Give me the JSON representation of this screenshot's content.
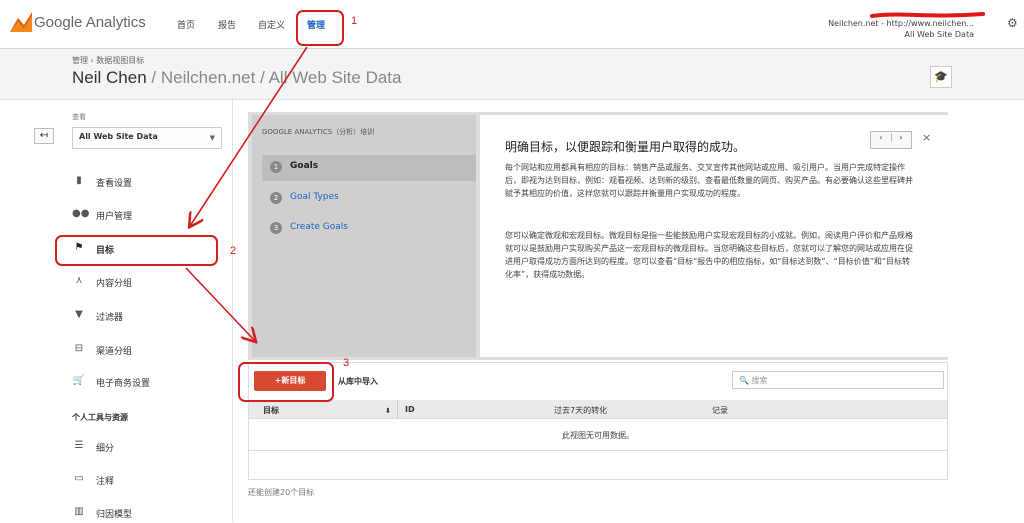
{
  "header": {
    "logo": "Google Analytics",
    "nav": [
      "首页",
      "报告",
      "自定义",
      "管理"
    ],
    "account_line1": "Neilchen.net - http://www.neilchen...",
    "account_line2": "All Web Site Data"
  },
  "subheader": {
    "breadcrumb": "管理 › 数据视图目标",
    "title_main": "Neil Chen",
    "title_rest": "/ Neilchen.net / All Web Site Data"
  },
  "sidebar": {
    "view_label": "查看",
    "view_value": "All Web Site Data",
    "items": [
      {
        "icon": "document-icon",
        "label": "查看设置"
      },
      {
        "icon": "users-icon",
        "label": "用户管理"
      },
      {
        "icon": "flag-icon",
        "label": "目标"
      },
      {
        "icon": "content-group-icon",
        "label": "内容分组"
      },
      {
        "icon": "filter-icon",
        "label": "过滤器"
      },
      {
        "icon": "channel-group-icon",
        "label": "渠道分组"
      },
      {
        "icon": "cart-icon",
        "label": "电子商务设置"
      }
    ],
    "section_title": "个人工具与资源",
    "tools": [
      {
        "icon": "segment-icon",
        "label": "细分"
      },
      {
        "icon": "comment-icon",
        "label": "注释"
      },
      {
        "icon": "attribution-icon",
        "label": "归因模型"
      }
    ]
  },
  "training": {
    "heading": "GOOGLE ANALYTICS（分析）培训",
    "steps": [
      {
        "num": "1",
        "label": "Goals"
      },
      {
        "num": "2",
        "label": "Goal Types"
      },
      {
        "num": "3",
        "label": "Create Goals"
      }
    ],
    "title": "明确目标，以便跟踪和衡量用户取得的成功。",
    "para1": "每个网站和应用都具有相应的目标：销售产品或服务、交叉宣传其他网站或应用、吸引用户。当用户完成特定操作后，即视为达到目标，例如：观看视频、达到新的级别、查看最低数量的网页、购买产品。有必要确认这些里程碑并赋予其相应的价值，这样您就可以跟踪并衡量用户实现成功的程度。",
    "para2": "您可以确定微观和宏观目标。微观目标是指一些能鼓励用户实现宏观目标的小成就。例如，阅读用户评价和产品规格就可以是鼓励用户实现购买产品这一宏观目标的微观目标。当您明确这些目标后，您就可以了解您的网站或应用在促进用户取得成功方面所达到的程度。您可以查看“目标”报告中的相应指标，如“目标达到数”、“目标价值”和“目标转化率”，获得成功数据。",
    "nav_prev": "‹",
    "nav_next": "›",
    "close": "×"
  },
  "goals": {
    "new_button": "+新目标",
    "import": "从库中导入",
    "search_placeholder": "搜索",
    "columns": [
      "目标",
      "ID",
      "过去7天的转化",
      "记录"
    ],
    "empty": "此视图无可用数据。",
    "remaining": "还能创建20个目标"
  },
  "annotations": [
    "1",
    "2",
    "3"
  ],
  "colors": {
    "accent": "#d54a31",
    "annotation": "#d12020",
    "link": "#1b63c8"
  }
}
